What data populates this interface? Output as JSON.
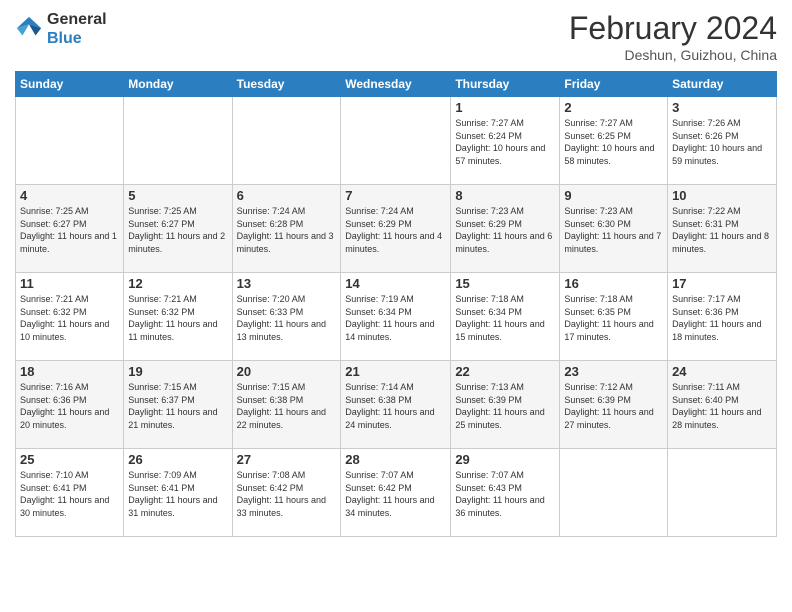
{
  "header": {
    "logo_line1": "General",
    "logo_line2": "Blue",
    "title": "February 2024",
    "location": "Deshun, Guizhou, China"
  },
  "days_of_week": [
    "Sunday",
    "Monday",
    "Tuesday",
    "Wednesday",
    "Thursday",
    "Friday",
    "Saturday"
  ],
  "weeks": [
    [
      {
        "day": "",
        "info": ""
      },
      {
        "day": "",
        "info": ""
      },
      {
        "day": "",
        "info": ""
      },
      {
        "day": "",
        "info": ""
      },
      {
        "day": "1",
        "info": "Sunrise: 7:27 AM\nSunset: 6:24 PM\nDaylight: 10 hours and 57 minutes."
      },
      {
        "day": "2",
        "info": "Sunrise: 7:27 AM\nSunset: 6:25 PM\nDaylight: 10 hours and 58 minutes."
      },
      {
        "day": "3",
        "info": "Sunrise: 7:26 AM\nSunset: 6:26 PM\nDaylight: 10 hours and 59 minutes."
      }
    ],
    [
      {
        "day": "4",
        "info": "Sunrise: 7:25 AM\nSunset: 6:27 PM\nDaylight: 11 hours and 1 minute."
      },
      {
        "day": "5",
        "info": "Sunrise: 7:25 AM\nSunset: 6:27 PM\nDaylight: 11 hours and 2 minutes."
      },
      {
        "day": "6",
        "info": "Sunrise: 7:24 AM\nSunset: 6:28 PM\nDaylight: 11 hours and 3 minutes."
      },
      {
        "day": "7",
        "info": "Sunrise: 7:24 AM\nSunset: 6:29 PM\nDaylight: 11 hours and 4 minutes."
      },
      {
        "day": "8",
        "info": "Sunrise: 7:23 AM\nSunset: 6:29 PM\nDaylight: 11 hours and 6 minutes."
      },
      {
        "day": "9",
        "info": "Sunrise: 7:23 AM\nSunset: 6:30 PM\nDaylight: 11 hours and 7 minutes."
      },
      {
        "day": "10",
        "info": "Sunrise: 7:22 AM\nSunset: 6:31 PM\nDaylight: 11 hours and 8 minutes."
      }
    ],
    [
      {
        "day": "11",
        "info": "Sunrise: 7:21 AM\nSunset: 6:32 PM\nDaylight: 11 hours and 10 minutes."
      },
      {
        "day": "12",
        "info": "Sunrise: 7:21 AM\nSunset: 6:32 PM\nDaylight: 11 hours and 11 minutes."
      },
      {
        "day": "13",
        "info": "Sunrise: 7:20 AM\nSunset: 6:33 PM\nDaylight: 11 hours and 13 minutes."
      },
      {
        "day": "14",
        "info": "Sunrise: 7:19 AM\nSunset: 6:34 PM\nDaylight: 11 hours and 14 minutes."
      },
      {
        "day": "15",
        "info": "Sunrise: 7:18 AM\nSunset: 6:34 PM\nDaylight: 11 hours and 15 minutes."
      },
      {
        "day": "16",
        "info": "Sunrise: 7:18 AM\nSunset: 6:35 PM\nDaylight: 11 hours and 17 minutes."
      },
      {
        "day": "17",
        "info": "Sunrise: 7:17 AM\nSunset: 6:36 PM\nDaylight: 11 hours and 18 minutes."
      }
    ],
    [
      {
        "day": "18",
        "info": "Sunrise: 7:16 AM\nSunset: 6:36 PM\nDaylight: 11 hours and 20 minutes."
      },
      {
        "day": "19",
        "info": "Sunrise: 7:15 AM\nSunset: 6:37 PM\nDaylight: 11 hours and 21 minutes."
      },
      {
        "day": "20",
        "info": "Sunrise: 7:15 AM\nSunset: 6:38 PM\nDaylight: 11 hours and 22 minutes."
      },
      {
        "day": "21",
        "info": "Sunrise: 7:14 AM\nSunset: 6:38 PM\nDaylight: 11 hours and 24 minutes."
      },
      {
        "day": "22",
        "info": "Sunrise: 7:13 AM\nSunset: 6:39 PM\nDaylight: 11 hours and 25 minutes."
      },
      {
        "day": "23",
        "info": "Sunrise: 7:12 AM\nSunset: 6:39 PM\nDaylight: 11 hours and 27 minutes."
      },
      {
        "day": "24",
        "info": "Sunrise: 7:11 AM\nSunset: 6:40 PM\nDaylight: 11 hours and 28 minutes."
      }
    ],
    [
      {
        "day": "25",
        "info": "Sunrise: 7:10 AM\nSunset: 6:41 PM\nDaylight: 11 hours and 30 minutes."
      },
      {
        "day": "26",
        "info": "Sunrise: 7:09 AM\nSunset: 6:41 PM\nDaylight: 11 hours and 31 minutes."
      },
      {
        "day": "27",
        "info": "Sunrise: 7:08 AM\nSunset: 6:42 PM\nDaylight: 11 hours and 33 minutes."
      },
      {
        "day": "28",
        "info": "Sunrise: 7:07 AM\nSunset: 6:42 PM\nDaylight: 11 hours and 34 minutes."
      },
      {
        "day": "29",
        "info": "Sunrise: 7:07 AM\nSunset: 6:43 PM\nDaylight: 11 hours and 36 minutes."
      },
      {
        "day": "",
        "info": ""
      },
      {
        "day": "",
        "info": ""
      }
    ]
  ]
}
